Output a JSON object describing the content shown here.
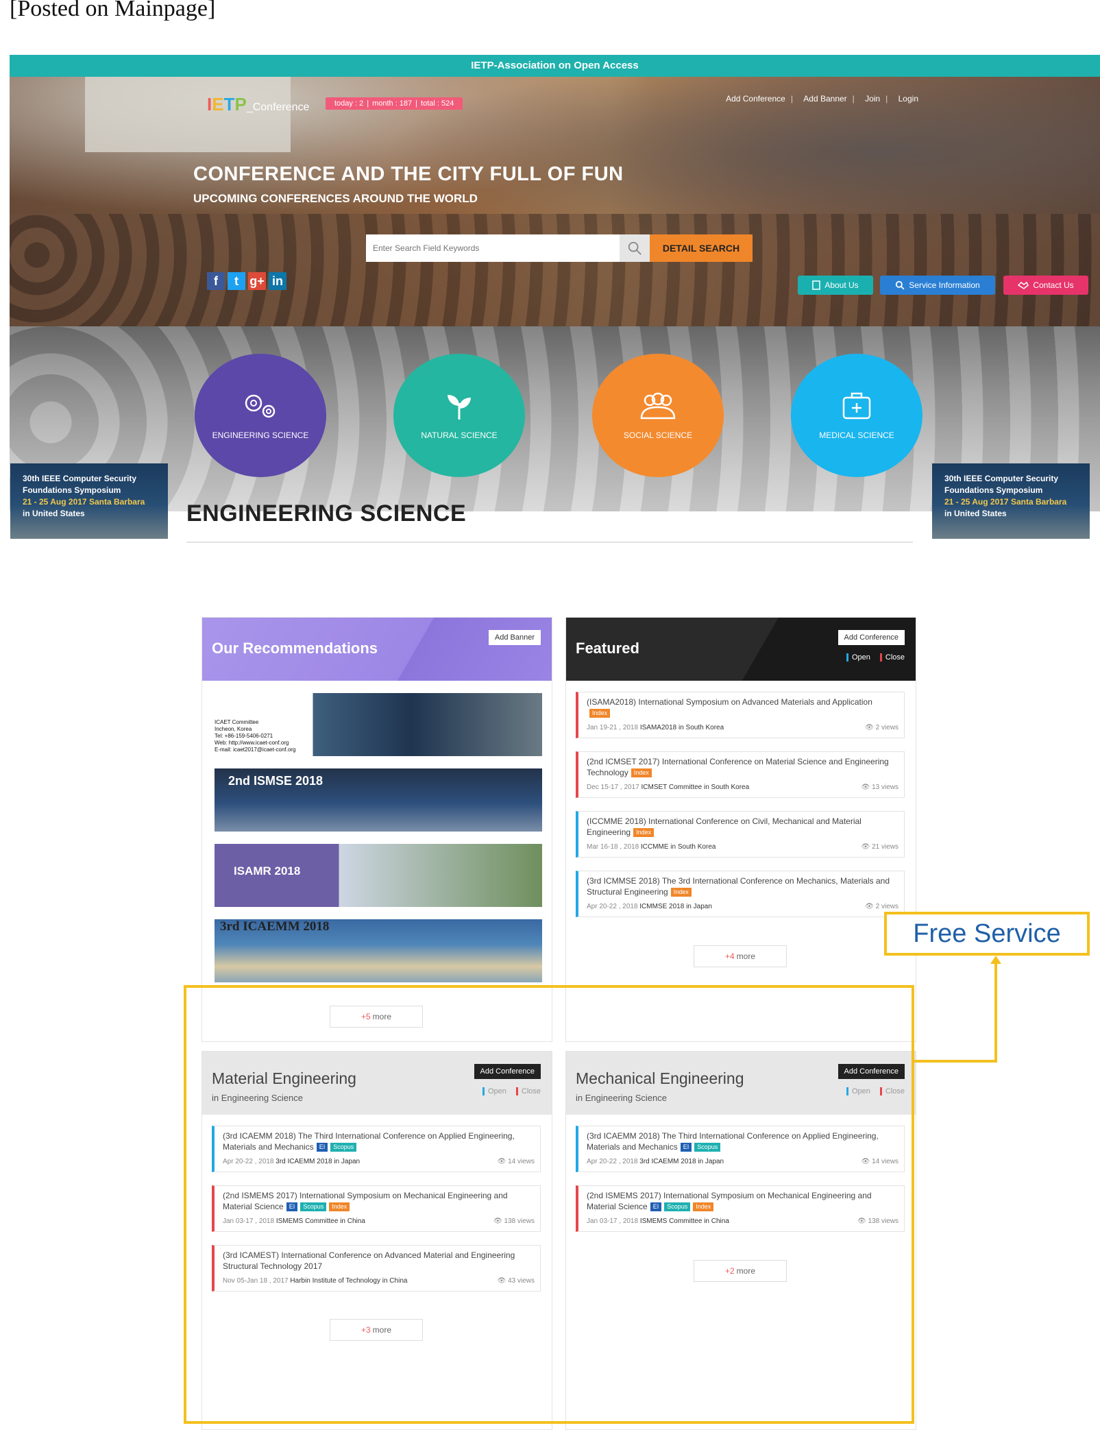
{
  "caption": "[Posted on Mainpage]",
  "topbar": {
    "title": "IETP-Association on Open Access"
  },
  "header": {
    "logo": {
      "part1": "I",
      "part2": "E",
      "part3": "T",
      "part4": "P",
      "part5": "_Conference"
    },
    "stats": {
      "today": "today : 2",
      "month": "month : 187",
      "total": "total : 524"
    },
    "links": [
      "Add Conference",
      "Add Banner",
      "Join",
      "Login"
    ]
  },
  "hero": {
    "title": "CONFERENCE AND THE CITY FULL OF FUN",
    "subtitle": "UPCOMING CONFERENCES AROUND THE WORLD",
    "search_placeholder": "Enter Search Field Keywords",
    "detail_search": "DETAIL SEARCH",
    "social": [
      "f",
      "t",
      "g+",
      "in"
    ],
    "buttons": {
      "about": "About Us",
      "service": "Service Information",
      "contact": "Contact Us"
    }
  },
  "categories": [
    "ENGINEERING SCIENCE",
    "NATURAL SCIENCE",
    "SOCIAL SCIENCE",
    "MEDICAL SCIENCE"
  ],
  "side_ad": {
    "line1": "30th IEEE Computer Security",
    "line2": "Foundations Symposium",
    "line3": "21 - 25 Aug 2017 Santa Barbara",
    "line4": "in United States"
  },
  "section_title": "ENGINEERING SCIENCE",
  "recommendations": {
    "title": "Our Recommendations",
    "add_banner": "Add Banner",
    "banner1_text": "ICAET Committee\nIncheon, Korea\nTel: +86-159-5406-0271\nWeb: http://www.icaet-conf.org\nE-mail: icaet2017@icaet-conf.org",
    "banner2": "2nd ISMSE 2018",
    "banner3": "ISAMR 2018",
    "banner4": "3rd ICAEMM 2018",
    "more_num": "+5",
    "more_label": "more"
  },
  "featured": {
    "title": "Featured",
    "add_conference": "Add Conference",
    "open": "Open",
    "close": "Close",
    "items": [
      {
        "title": "(ISAMA2018) International Symposium on Advanced Materials and Application",
        "date": "Jan 19-21 , 2018",
        "org": "ISAMA2018 in South Korea",
        "views": "2 views"
      },
      {
        "title": "(2nd ICMSET 2017) International Conference on Material Science and Engineering Technology",
        "date": "Dec 15-17 , 2017",
        "org": "ICMSET Committee in South Korea",
        "views": "13 views"
      },
      {
        "title": "(ICCMME 2018) International Conference on Civil, Mechanical and Material Engineering",
        "date": "Mar 16-18 , 2018",
        "org": "ICCMME in South Korea",
        "views": "21 views"
      },
      {
        "title": "(3rd ICMMSE 2018) The 3rd International Conference on Mechanics, Materials and Structural Engineering",
        "date": "Apr 20-22 , 2018",
        "org": "ICMMSE 2018 in Japan",
        "views": "2 views"
      }
    ],
    "tag_index": "Index",
    "more_num": "+4",
    "more_label": "more"
  },
  "material": {
    "title": "Material Engineering",
    "sub": "in Engineering Science",
    "add_conference": "Add Conference",
    "open": "Open",
    "close": "Close",
    "items": [
      {
        "title": "(3rd ICAEMM 2018) The Third International Conference on Applied Engineering, Materials and Mechanics",
        "date": "Apr 20-22 , 2018",
        "org": "3rd ICAEMM 2018 in Japan",
        "views": "14 views"
      },
      {
        "title": "(2nd ISMEMS 2017) International Symposium on Mechanical Engineering and Material Science",
        "date": "Jan 03-17 , 2018",
        "org": "ISMEMS Committee in China",
        "views": "138 views"
      },
      {
        "title": "(3rd ICAMEST) International Conference on Advanced Material and Engineering Structural Technology 2017",
        "date": "Nov 05-Jan 18 , 2017",
        "org": "Harbin Institute of Technology in China",
        "views": "43 views"
      }
    ],
    "tag_ei": "EI",
    "tag_scopus": "Scopus",
    "tag_index": "Index",
    "more_num": "+3",
    "more_label": "more"
  },
  "mechanical": {
    "title": "Mechanical Engineering",
    "sub": "in Engineering Science",
    "add_conference": "Add Conference",
    "open": "Open",
    "close": "Close",
    "items": [
      {
        "title": "(3rd ICAEMM 2018) The Third International Conference on Applied Engineering, Materials and Mechanics",
        "date": "Apr 20-22 , 2018",
        "org": "3rd ICAEMM 2018 in Japan",
        "views": "14 views"
      },
      {
        "title": "(2nd ISMEMS 2017) International Symposium on Mechanical Engineering and Material Science",
        "date": "Jan 03-17 , 2018",
        "org": "ISMEMS Committee in China",
        "views": "138 views"
      }
    ],
    "more_num": "+2",
    "more_label": "more"
  },
  "free_service": "Free Service",
  "colors": {
    "teal": "#1fb1ad",
    "orange": "#f0862a",
    "highlight": "#f4c01e",
    "purple": "#5b48a8"
  }
}
